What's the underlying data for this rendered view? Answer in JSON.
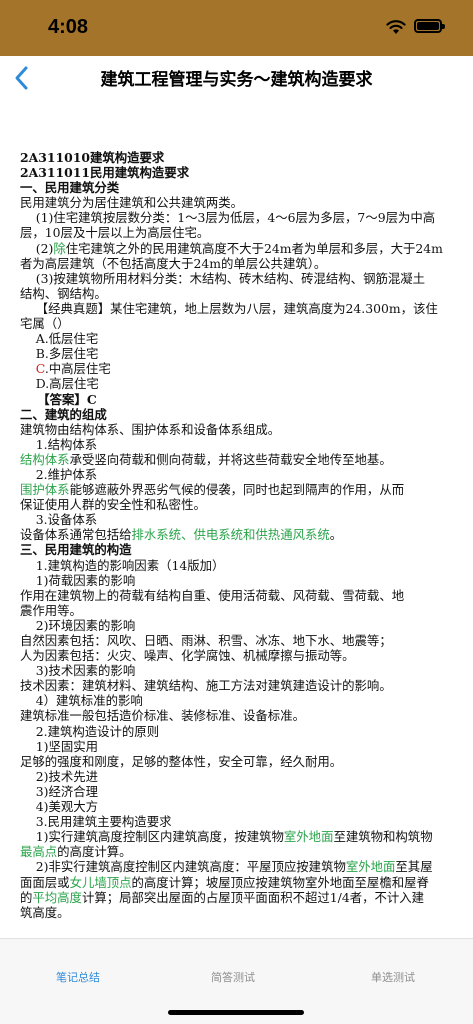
{
  "status_bar": {
    "time": "4:08"
  },
  "nav": {
    "title": "建筑工程管理与实务～建筑构造要求"
  },
  "content_lines": [
    [
      {
        "t": "2A311010建筑构造要求",
        "s": "b"
      }
    ],
    [
      {
        "t": "2A311011民用建筑构造要求",
        "s": "b"
      }
    ],
    [
      {
        "t": "一、民用建筑分类",
        "s": "b"
      }
    ],
    [
      {
        "t": "民用建筑分为居住建筑和公共建筑两类。"
      }
    ],
    [
      {
        "t": "    (1)住宅建筑按层数分类：1～3层为低层，4～6层为多层，7～9层为中高"
      }
    ],
    [
      {
        "t": "层，10层及十层以上为高层住宅。"
      }
    ],
    [
      {
        "t": "    (2)"
      },
      {
        "t": "除",
        "s": "g"
      },
      {
        "t": "住宅建筑之外的民用建筑高度不大于24m者为单层和多层，大于24m"
      }
    ],
    [
      {
        "t": "者为高层建筑（不包括高度大于24m的单层公共建筑）。"
      }
    ],
    [
      {
        "t": "    (3)按建筑物所用材料分类：木结构、砖木结构、砖混结构、钢筋混凝土"
      }
    ],
    [
      {
        "t": "结构、钢结构。"
      }
    ],
    [
      {
        "t": "    【经典真题】某住宅建筑，地上层数为八层，建筑高度为24.300m，该住"
      }
    ],
    [
      {
        "t": "宅属（）"
      }
    ],
    [
      {
        "t": "    A.低层住宅"
      }
    ],
    [
      {
        "t": "    B.多层住宅"
      }
    ],
    [
      {
        "t": "    "
      },
      {
        "t": "C",
        "s": "r"
      },
      {
        "t": ".中高层住宅"
      }
    ],
    [
      {
        "t": "    D.高层住宅"
      }
    ],
    [
      {
        "t": "    【答案】C",
        "s": "b"
      }
    ],
    [
      {
        "t": "二、建筑的组成",
        "s": "b"
      }
    ],
    [
      {
        "t": "建筑物由结构体系、围护体系和设备体系组成。"
      }
    ],
    [
      {
        "t": "    1.结构体系"
      }
    ],
    [
      {
        "t": "结构体系",
        "s": "g"
      },
      {
        "t": "承受竖向荷载和侧向荷载，并将这些荷载安全地传至地基。"
      }
    ],
    [
      {
        "t": "    2.维护体系"
      }
    ],
    [
      {
        "t": "围护体系",
        "s": "g"
      },
      {
        "t": "能够遮蔽外界恶劣气候的侵袭，同时也起到隔声的作用，从而"
      }
    ],
    [
      {
        "t": "保证使用人群的安全性和私密性。"
      }
    ],
    [
      {
        "t": "    3.设备体系"
      }
    ],
    [
      {
        "t": "设备体系通常包括给"
      },
      {
        "t": "排水系统、供电系统和供热通风系统",
        "s": "g"
      },
      {
        "t": "。"
      }
    ],
    [
      {
        "t": "三、民用建筑的构造",
        "s": "b"
      }
    ],
    [
      {
        "t": "    1.建筑构造的影响因素（14版加）"
      }
    ],
    [
      {
        "t": "    1)荷载因素的影响"
      }
    ],
    [
      {
        "t": "作用在建筑物上的荷载有结构自重、使用活荷载、风荷载、雪荷载、地"
      }
    ],
    [
      {
        "t": "震作用等。"
      }
    ],
    [
      {
        "t": "    2)环境因素的影响"
      }
    ],
    [
      {
        "t": "自然因素包括：风吹、日晒、雨淋、积雪、冰冻、地下水、地震等；"
      }
    ],
    [
      {
        "t": "人为因素包括：火灾、噪声、化学腐蚀、机械摩擦与振动等。"
      }
    ],
    [
      {
        "t": "    3)技术因素的影响"
      }
    ],
    [
      {
        "t": "技术因素：建筑材料、建筑结构、施工方法对建筑建造设计的影响。"
      }
    ],
    [
      {
        "t": "    4）建筑标准的影响"
      }
    ],
    [
      {
        "t": "建筑标准一般包括造价标准、装修标准、设备标准。"
      }
    ],
    [
      {
        "t": "    2.建筑构造设计的原则"
      }
    ],
    [
      {
        "t": "    1)坚固实用"
      }
    ],
    [
      {
        "t": "足够的强度和刚度，足够的整体性，安全可靠，经久耐用。"
      }
    ],
    [
      {
        "t": "    2)技术先进"
      }
    ],
    [
      {
        "t": "    3)经济合理"
      }
    ],
    [
      {
        "t": "    4)美观大方"
      }
    ],
    [
      {
        "t": "    3.民用建筑主要构造要求"
      }
    ],
    [
      {
        "t": "    1)实行建筑高度控制区内建筑高度，按建筑物"
      },
      {
        "t": "室外地面",
        "s": "g"
      },
      {
        "t": "至建筑物和构筑物"
      }
    ],
    [
      {
        "t": "最高点",
        "s": "g"
      },
      {
        "t": "的高度计算。"
      }
    ],
    [
      {
        "t": "    2)非实行建筑高度控制区内建筑高度：平屋顶应按建筑物"
      },
      {
        "t": "室外地面",
        "s": "g"
      },
      {
        "t": "至其屋"
      }
    ],
    [
      {
        "t": "面面层或"
      },
      {
        "t": "女儿墙顶点",
        "s": "g"
      },
      {
        "t": "的高度计算；坡屋顶应按建筑物室外地面至屋檐和屋脊"
      }
    ],
    [
      {
        "t": "的"
      },
      {
        "t": "平均高度",
        "s": "g"
      },
      {
        "t": "计算；局部突出屋面的占屋顶平面面积不超过1/4者，不计入建"
      }
    ],
    [
      {
        "t": "筑高度。"
      }
    ]
  ],
  "tabs": [
    {
      "label": "笔记总结",
      "active": true
    },
    {
      "label": "简答测试",
      "active": false
    },
    {
      "label": "单选测试",
      "active": false
    }
  ],
  "colors": {
    "status_bar": "#a4742a",
    "highlight": "#2aa34a",
    "answer_mark": "#d42020",
    "tab_active": "#2f8ad8",
    "tab_inactive": "#8e8e8e"
  },
  "icons": {
    "back": "chevron-left-icon",
    "wifi": "wifi-icon",
    "battery": "battery-icon"
  }
}
